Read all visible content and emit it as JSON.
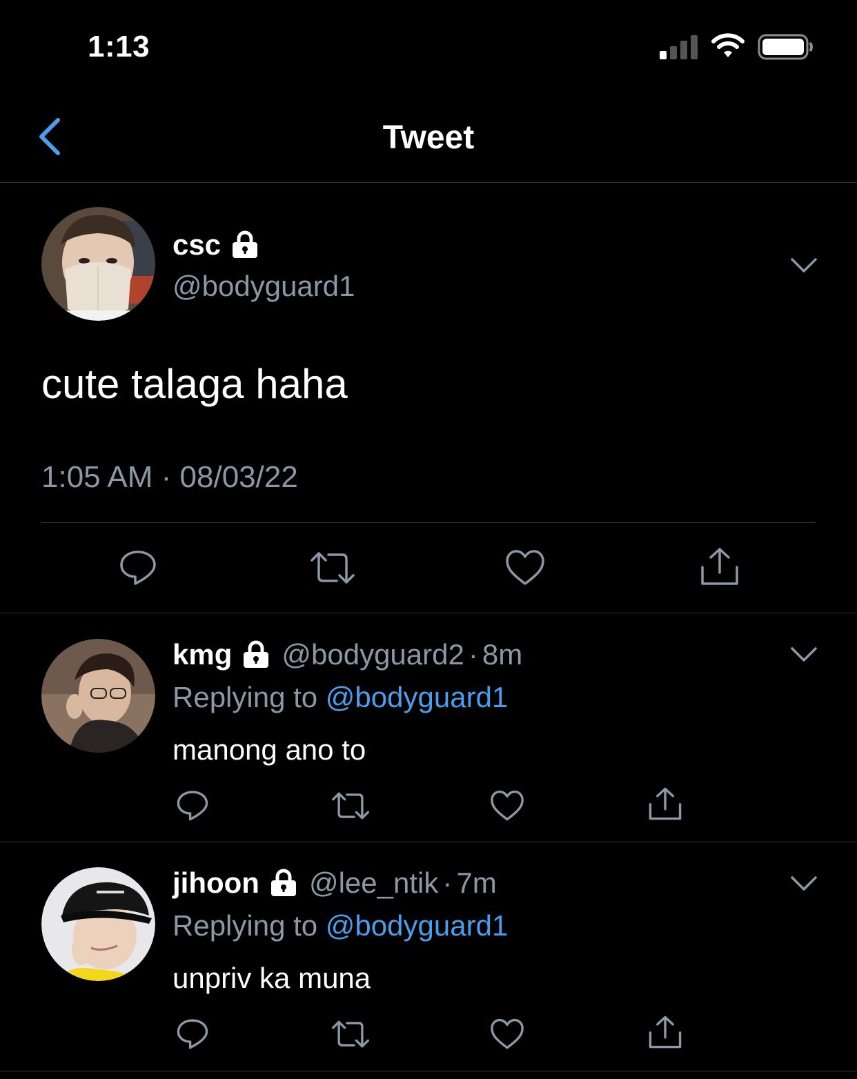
{
  "status_bar": {
    "time": "1:13"
  },
  "nav": {
    "title": "Tweet"
  },
  "main_tweet": {
    "name": "csc",
    "handle": "@bodyguard1",
    "text": "cute talaga haha",
    "timestamp": "1:05 AM · 08/03/22"
  },
  "replies": [
    {
      "name": "kmg",
      "handle": "@bodyguard2",
      "separator": "·",
      "ago": "8m",
      "replying_prefix": "Replying to",
      "replying_to": "@bodyguard1",
      "text": "manong ano to"
    },
    {
      "name": "jihoon",
      "handle": "@lee_ntik",
      "separator": "·",
      "ago": "7m",
      "replying_prefix": "Replying to",
      "replying_to": "@bodyguard1",
      "text": "unpriv ka muna"
    }
  ],
  "icons": [
    "back-chevron-icon",
    "lock-icon",
    "chevron-down-icon",
    "reply-icon",
    "retweet-icon",
    "like-icon",
    "share-icon"
  ],
  "colors": {
    "background": "#000000",
    "accent": "#4a9eed",
    "secondary_text": "#8b98a5",
    "divider": "#2f3336"
  }
}
